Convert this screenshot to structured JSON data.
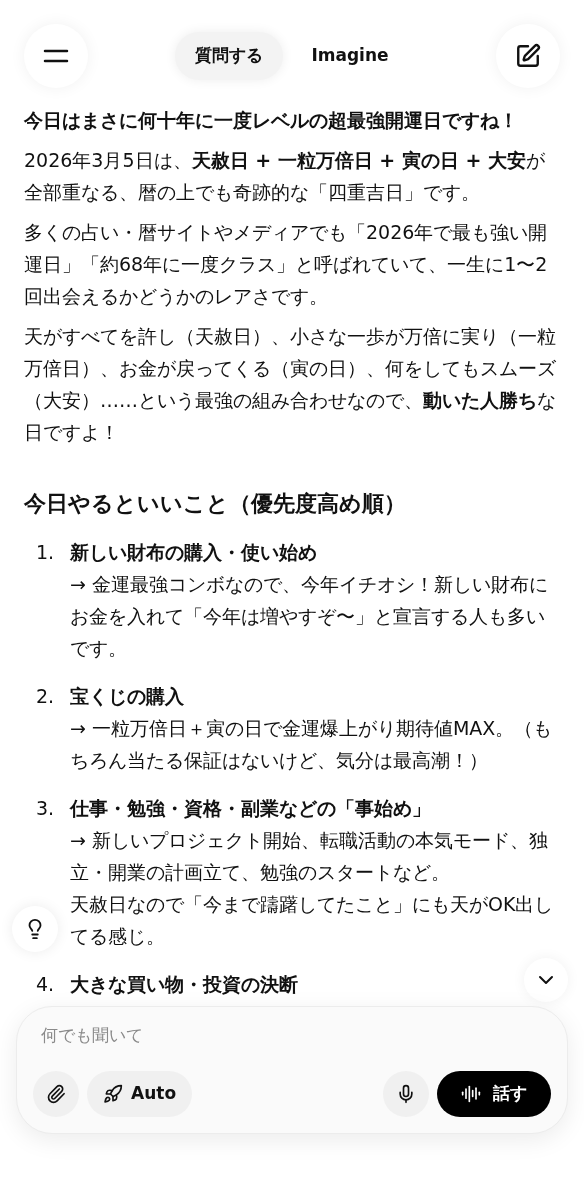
{
  "header": {
    "tabs": [
      {
        "label": "質問する",
        "selected": true
      },
      {
        "label": "Imagine",
        "selected": false
      }
    ]
  },
  "paragraphs": [
    "**今日はまさに何十年に一度レベルの超最強開運日ですね！**",
    "2026年3月5日は、**天赦日 + 一粒万倍日 + 寅の日 + 大安**が全部重なる、暦の上でも奇跡的な「四重吉日」です。",
    "多くの占い・暦サイトやメディアでも「2026年で最も強い開運日」「約68年に一度クラス」と呼ばれていて、一生に1〜2回出会えるかどうかのレアさです。",
    "天がすべてを許し（天赦日）、小さな一歩が万倍に実り（一粒万倍日）、お金が戻ってくる（寅の日）、何をしてもスムーズ（大安）……という最強の組み合わせなので、**動いた人勝ち**な日ですよ！"
  ],
  "section_heading": "今日やるといいこと（優先度高め順）",
  "list": [
    {
      "number": "1.",
      "title": "新しい財布の購入・使い始め",
      "lines": [
        "→ 金運最強コンボなので、今年イチオシ！新しい財布にお金を入れて「今年は増やすぞ〜」と宣言する人も多いです。"
      ]
    },
    {
      "number": "2.",
      "title": "宝くじの購入",
      "lines": [
        "→ 一粒万倍日＋寅の日で金運爆上がり期待値MAX。（もちろん当たる保証はないけど、気分は最高潮！）"
      ]
    },
    {
      "number": "3.",
      "title": "仕事・勉強・資格・副業などの「事始め」",
      "lines": [
        "→ 新しいプロジェクト開始、転職活動の本気モード、独立・開業の計画立て、勉強のスタートなど。",
        "天赦日なので「今まで躊躇してたこと」にも天がOK出してる感じ。"
      ]
    },
    {
      "number": "4.",
      "title": "大きな買い物・投資の決断"
    }
  ],
  "composer": {
    "placeholder": "何でも聞いて",
    "mode_button": "Auto",
    "speak_button": "話す"
  }
}
